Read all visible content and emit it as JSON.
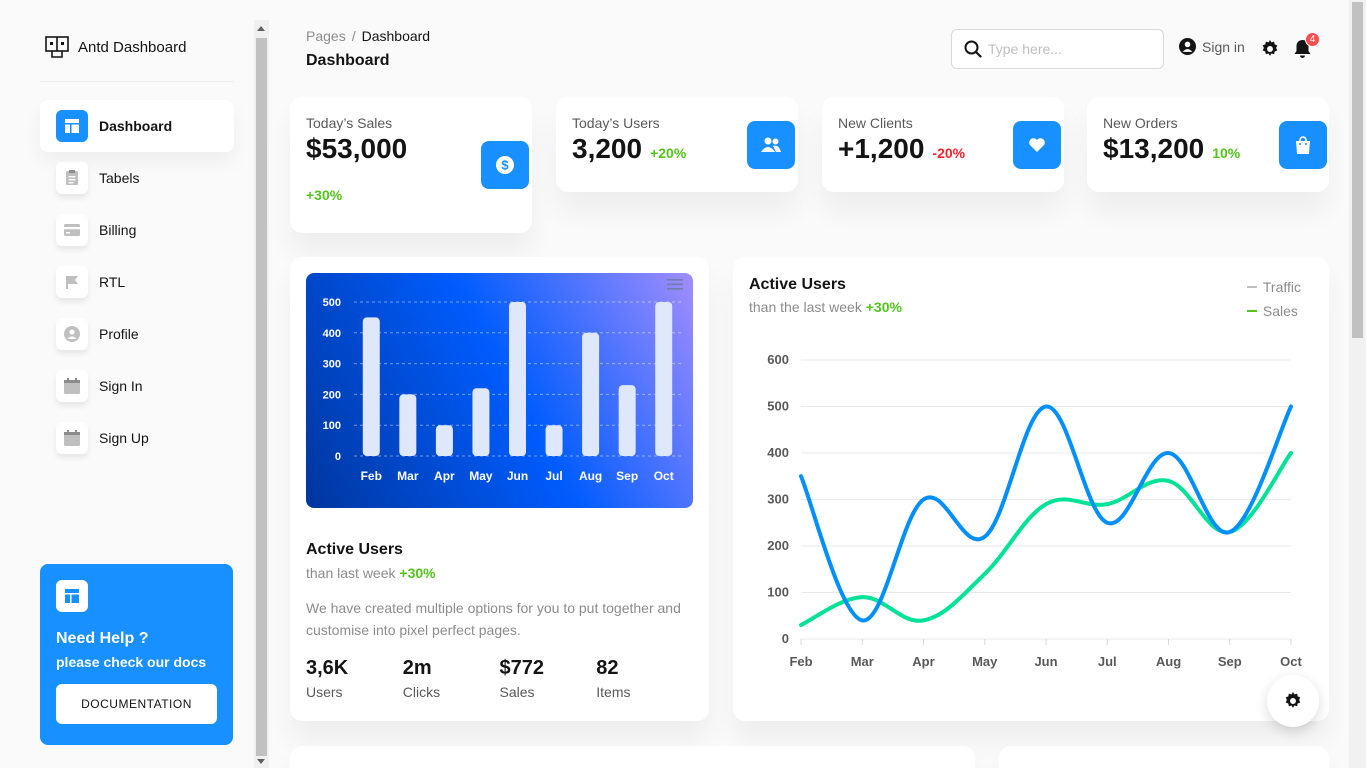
{
  "brand": {
    "name": "Antd Dashboard"
  },
  "sidebar": {
    "items": [
      {
        "label": "Dashboard",
        "icon": "dashboard-icon",
        "active": true
      },
      {
        "label": "Tabels",
        "icon": "table-icon"
      },
      {
        "label": "Billing",
        "icon": "credit-card-icon"
      },
      {
        "label": "RTL",
        "icon": "flag-icon"
      },
      {
        "label": "Profile",
        "icon": "user-icon"
      },
      {
        "label": "Sign In",
        "icon": "calendar-icon"
      },
      {
        "label": "Sign Up",
        "icon": "calendar-icon"
      }
    ],
    "help": {
      "title": "Need Help ?",
      "subtitle": "please check our docs",
      "button": "DOCUMENTATION"
    }
  },
  "header": {
    "breadcrumb_root": "Pages",
    "breadcrumb_sep": "/",
    "breadcrumb_current": "Dashboard",
    "title": "Dashboard",
    "search_placeholder": "Type here...",
    "signin_label": "Sign in",
    "notification_count": "4"
  },
  "stats": [
    {
      "label": "Today’s Sales",
      "value": "$53,000",
      "change": "+30%",
      "trend": "up",
      "icon": "dollar-icon"
    },
    {
      "label": "Today’s Users",
      "value": "3,200",
      "change": "+20%",
      "trend": "up",
      "icon": "users-icon"
    },
    {
      "label": "New Clients",
      "value": "+1,200",
      "change": "-20%",
      "trend": "down",
      "icon": "heart-icon"
    },
    {
      "label": "New Orders",
      "value": "$13,200",
      "change": "10%",
      "trend": "up",
      "icon": "shopping-bag-icon"
    }
  ],
  "active_users_card": {
    "title": "Active Users",
    "subtitle_prefix": "than last week",
    "subtitle_change": "+30%",
    "description": "We have created multiple options for you to put together and customise into pixel perfect pages.",
    "mini_stats": [
      {
        "value": "3,6K",
        "label": "Users"
      },
      {
        "value": "2m",
        "label": "Clicks"
      },
      {
        "value": "$772",
        "label": "Sales"
      },
      {
        "value": "82",
        "label": "Items"
      }
    ]
  },
  "line_card": {
    "title": "Active Users",
    "subtitle_prefix": "than the last week",
    "subtitle_change": "+30%"
  },
  "colors": {
    "primary": "#1890ff",
    "positive": "#52c41a",
    "negative": "#f5222d",
    "traffic": "#008ffb",
    "sales": "#00e396"
  },
  "chart_data": [
    {
      "type": "bar",
      "categories": [
        "Feb",
        "Mar",
        "Apr",
        "May",
        "Jun",
        "Jul",
        "Aug",
        "Sep",
        "Oct"
      ],
      "values": [
        450,
        200,
        100,
        220,
        500,
        100,
        400,
        230,
        500
      ],
      "yticks": [
        "0",
        "100",
        "200",
        "300",
        "400",
        "500"
      ],
      "ylim": [
        0,
        500
      ],
      "grid": true
    },
    {
      "type": "line",
      "categories": [
        "Feb",
        "Mar",
        "Apr",
        "May",
        "Jun",
        "Jul",
        "Aug",
        "Sep",
        "Oct"
      ],
      "series": [
        {
          "name": "Traffic",
          "values": [
            350,
            40,
            300,
            220,
            500,
            250,
            400,
            230,
            500
          ]
        },
        {
          "name": "Sales",
          "values": [
            30,
            90,
            40,
            140,
            290,
            290,
            340,
            230,
            400
          ]
        }
      ],
      "yticks": [
        "0",
        "100",
        "200",
        "300",
        "400",
        "500",
        "600"
      ],
      "ylim": [
        0,
        600
      ],
      "legend": "top-right",
      "grid": true
    }
  ]
}
